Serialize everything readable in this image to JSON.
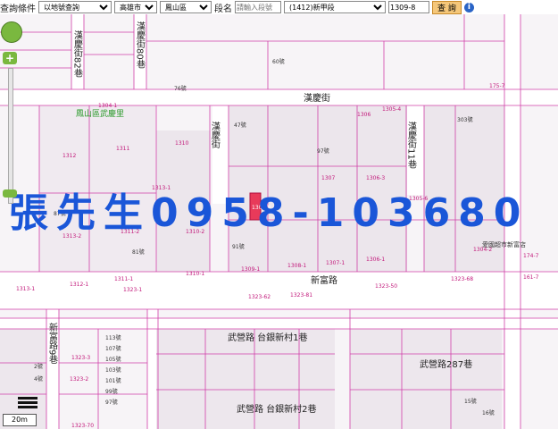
{
  "query_bar": {
    "label_query": "查詢條件",
    "query_type": "以地號查詢",
    "city": "高雄市",
    "district": "鳳山區",
    "label_section": "段名",
    "section_placeholder": "請輸入段號",
    "section_select": "(1412)新甲段",
    "lot_number": "1309-8",
    "search_button": "查 詢"
  },
  "overlay": {
    "ad_text": "張先生0958-103680"
  },
  "map": {
    "roads": {
      "hanqing": "漢慶街",
      "hanqing_lane": "漢慶街",
      "hanqing_lane_11": "漢慶街11巷",
      "xinfu": "新富路",
      "wuqing": "武營路",
      "wuqing_lane": "武營路 台銀新村1巷",
      "wuqing_lane2": "武營路 台銀新村2巷",
      "wuqing_287": "武營路287巷",
      "xinfu_9": "新富路9巷",
      "lane_80": "漢慶街80巷",
      "lane_82": "漢慶街82巷"
    },
    "places": {
      "village": "鳳山區武慶里",
      "market": "愛國超市新富店"
    },
    "house_numbers": [
      "60號",
      "76號",
      "47號",
      "97號",
      "303號",
      "87號",
      "81號",
      "91號",
      "113號",
      "107號",
      "105號",
      "103號",
      "101號",
      "99號",
      "97號",
      "2號",
      "4號",
      "15號",
      "16號"
    ],
    "lot_labels": [
      "1304-1",
      "1306",
      "1305-4",
      "1312",
      "1311",
      "1310",
      "1307",
      "1306-3",
      "1305-6",
      "1313-1",
      "1313-2",
      "1311-2",
      "1310-2",
      "1309-1",
      "1308-1",
      "1307-1",
      "1306-1",
      "1304-2",
      "1313-1",
      "1312-1",
      "1311-1",
      "1323-1",
      "1310-1",
      "1323-62",
      "1323-81",
      "1323-50",
      "1323-68",
      "1323-3",
      "1323-2",
      "1323-70",
      "174-7",
      "161-7",
      "175-7"
    ],
    "highlighted_lot": "1309-8",
    "scale": "20m"
  },
  "colors": {
    "lot_lines": "#d03fa8",
    "ad_blue": "#1a56d8",
    "highlight": "#e83a5a",
    "green_label": "#2a9a2a"
  }
}
